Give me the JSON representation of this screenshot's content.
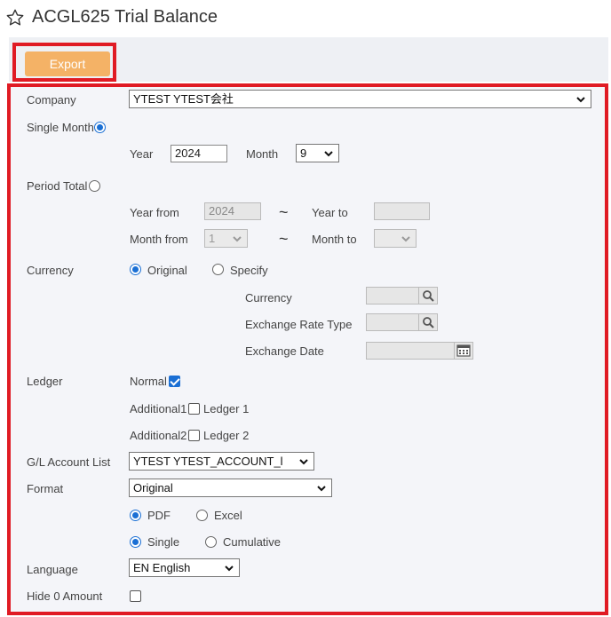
{
  "page": {
    "title": "ACGL625 Trial Balance"
  },
  "toolbar": {
    "export_label": "Export"
  },
  "form": {
    "company": {
      "label": "Company",
      "value": "YTEST YTEST会社"
    },
    "single_month": {
      "label": "Single Month",
      "selected": true,
      "year_label": "Year",
      "year_value": "2024",
      "month_label": "Month",
      "month_value": "9"
    },
    "period_total": {
      "label": "Period Total",
      "selected": false,
      "year_from_label": "Year from",
      "year_from_value": "2024",
      "year_to_label": "Year to",
      "year_to_value": "",
      "month_from_label": "Month from",
      "month_from_value": "1",
      "month_to_label": "Month to",
      "month_to_value": "",
      "separator": "~"
    },
    "currency": {
      "label": "Currency",
      "original_label": "Original",
      "specify_label": "Specify",
      "selected": "Original",
      "currency_label": "Currency",
      "exchange_rate_type_label": "Exchange Rate Type",
      "exchange_date_label": "Exchange Date"
    },
    "ledger": {
      "label": "Ledger",
      "normal_label": "Normal",
      "normal_checked": true,
      "additional1_label": "Additional1",
      "ledger1_label": "Ledger 1",
      "ledger1_checked": false,
      "additional2_label": "Additional2",
      "ledger2_label": "Ledger 2",
      "ledger2_checked": false
    },
    "gl_account_list": {
      "label": "G/L Account List",
      "value": "YTEST YTEST_ACCOUNT_l"
    },
    "format": {
      "label": "Format",
      "value": "Original",
      "pdf_label": "PDF",
      "excel_label": "Excel",
      "output_selected": "PDF",
      "single_label": "Single",
      "cumulative_label": "Cumulative",
      "mode_selected": "Single"
    },
    "language": {
      "label": "Language",
      "value": "EN English"
    },
    "hide_zero": {
      "label": "Hide 0 Amount",
      "checked": false
    }
  },
  "colors": {
    "accent_red": "#e01b24",
    "export_orange": "#f4b266",
    "radio_blue": "#1a6fd4"
  },
  "icons": {
    "favorite": "star-icon",
    "search": "search-icon",
    "calendar": "calendar-icon",
    "dropdown": "chevron-down-icon"
  }
}
